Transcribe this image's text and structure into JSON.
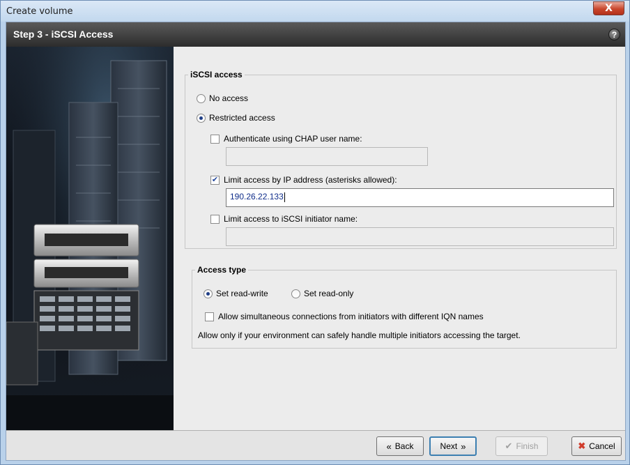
{
  "window": {
    "title": "Create volume",
    "close_glyph": "X"
  },
  "header": {
    "step_title": "Step 3 - iSCSI Access",
    "help_glyph": "?"
  },
  "iscsi_access": {
    "legend": "iSCSI access",
    "no_access_label": "No access",
    "restricted_access_label": "Restricted access",
    "selected": "restricted",
    "chap": {
      "label": "Authenticate using CHAP user name:",
      "checked": false,
      "value": ""
    },
    "ip": {
      "label": "Limit access by IP address (asterisks allowed):",
      "checked": true,
      "value": "190.26.22.133"
    },
    "initiator": {
      "label": "Limit access to iSCSI initiator name:",
      "checked": false,
      "value": ""
    }
  },
  "access_type": {
    "legend": "Access type",
    "read_write_label": "Set read-write",
    "read_only_label": "Set read-only",
    "selected": "read-write",
    "simultaneous": {
      "label": "Allow simultaneous connections from initiators with different IQN names",
      "checked": false
    },
    "note": "Allow only if your environment can safely handle multiple initiators accessing the target."
  },
  "footer": {
    "back_label": "Back",
    "next_label": "Next",
    "finish_label": "Finish",
    "cancel_label": "Cancel"
  },
  "icons": {
    "back": "double-chevron-left-icon",
    "next": "double-chevron-right-icon",
    "finish": "checkmark-icon",
    "cancel": "red-x-icon",
    "help": "help-icon"
  },
  "colors": {
    "header_bg": "#3a3a3a",
    "window_frame": "#b9d1ea",
    "close_red": "#c9462c",
    "link_blue": "#0f2d8a"
  }
}
